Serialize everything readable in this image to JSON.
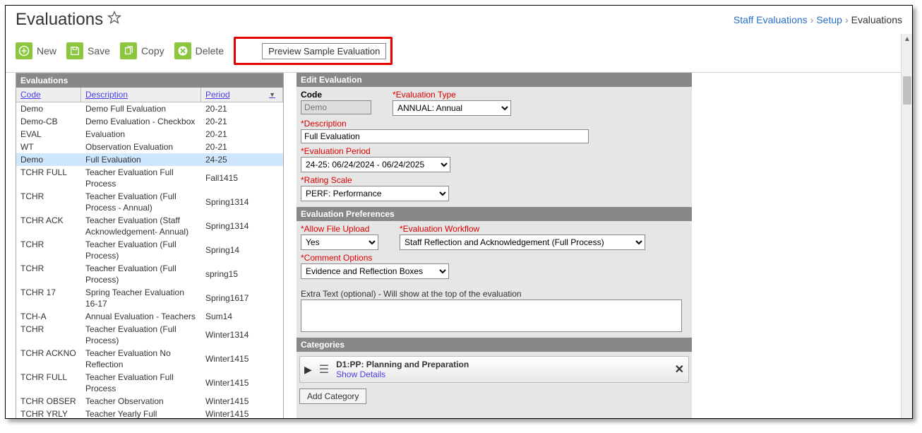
{
  "page_title": "Evaluations",
  "breadcrumb": {
    "a": "Staff Evaluations",
    "b": "Setup",
    "c": "Evaluations"
  },
  "toolbar": {
    "new": "New",
    "save": "Save",
    "copy": "Copy",
    "delete": "Delete",
    "preview": "Preview Sample Evaluation"
  },
  "left": {
    "title": "Evaluations",
    "cols": {
      "code": "Code",
      "desc": "Description",
      "period": "Period"
    },
    "rows": [
      {
        "code": "Demo",
        "desc": "Demo Full Evaluation",
        "period": "20-21"
      },
      {
        "code": "Demo-CB",
        "desc": "Demo Evaluation - Checkbox",
        "period": "20-21"
      },
      {
        "code": "EVAL",
        "desc": "Evaluation",
        "period": "20-21"
      },
      {
        "code": "WT",
        "desc": "Observation Evaluation",
        "period": "20-21"
      },
      {
        "code": "Demo",
        "desc": "Full Evaluation",
        "period": "24-25",
        "selected": true
      },
      {
        "code": "TCHR FULL",
        "desc": "Teacher Evaluation Full Process",
        "period": "Fall1415"
      },
      {
        "code": "TCHR",
        "desc": "Teacher Evaluation (Full Process - Annual)",
        "period": "Spring1314"
      },
      {
        "code": "TCHR ACK",
        "desc": "Teacher Evaluation (Staff Acknowledgement- Annual)",
        "period": "Spring1314"
      },
      {
        "code": "TCHR",
        "desc": "Teacher Evaluation (Full Process)",
        "period": "Spring14"
      },
      {
        "code": "TCHR",
        "desc": "Teacher Evaluation (Full Process)",
        "period": "spring15"
      },
      {
        "code": "TCHR 17",
        "desc": "Spring Teacher Evaluation 16-17",
        "period": "Spring1617"
      },
      {
        "code": "TCH-A",
        "desc": "Annual Evaluation - Teachers",
        "period": "Sum14"
      },
      {
        "code": "TCHR",
        "desc": "Teacher Evaluation (Full Process)",
        "period": "Winter1314"
      },
      {
        "code": "TCHR ACKNO",
        "desc": "Teacher Evaluation No Reflection",
        "period": "Winter1415"
      },
      {
        "code": "TCHR FULL",
        "desc": "Teacher Evaluation Full Process",
        "period": "Winter1415"
      },
      {
        "code": "TCHR OBSER",
        "desc": "Teacher Observation",
        "period": "Winter1415"
      },
      {
        "code": "TCHR YRLY",
        "desc": "Teacher Yearly Full",
        "period": "Winter1415"
      }
    ]
  },
  "edit": {
    "title": "Edit Evaluation",
    "code_lbl": "Code",
    "code_val": "Demo",
    "type_lbl": "*Evaluation Type",
    "type_val": "ANNUAL: Annual",
    "desc_lbl": "*Description",
    "desc_val": "Full Evaluation",
    "period_lbl": "*Evaluation Period",
    "period_val": "24-25: 06/24/2024 - 06/24/2025",
    "scale_lbl": "*Rating Scale",
    "scale_val": "PERF: Performance"
  },
  "prefs": {
    "title": "Evaluation Preferences",
    "upload_lbl": "*Allow File Upload",
    "upload_val": "Yes",
    "workflow_lbl": "*Evaluation Workflow",
    "workflow_val": "Staff Reflection and Acknowledgement (Full Process)",
    "comment_lbl": "*Comment Options",
    "comment_val": "Evidence and Reflection Boxes",
    "extra_lbl": "Extra Text (optional) - Will show at the top of the evaluation"
  },
  "cats": {
    "title": "Categories",
    "item_title": "D1:PP: Planning and Preparation",
    "show_details": "Show Details",
    "add_btn": "Add Category"
  }
}
